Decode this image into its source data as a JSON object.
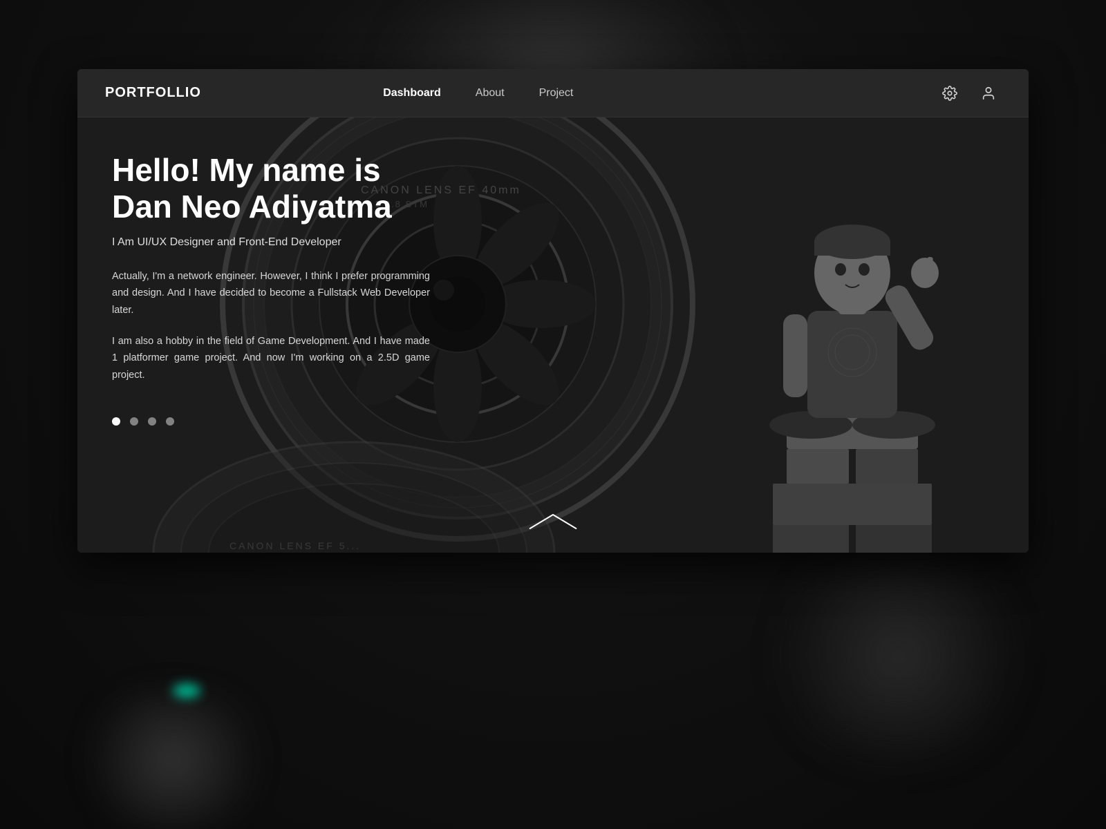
{
  "brand": "PORTFOLLIO",
  "nav": {
    "items": [
      {
        "label": "Dashboard",
        "active": true
      },
      {
        "label": "About",
        "active": false
      },
      {
        "label": "Project",
        "active": false
      }
    ]
  },
  "hero": {
    "title_line1": "Hello! My name is",
    "title_line2": "Dan Neo Adiyatma",
    "subtitle": "I Am UI/UX Designer and Front-End Developer",
    "body1": "Actually, I'm a network engineer. However, I think I prefer programming and design. And I have decided to become a Fullstack Web Developer later.",
    "body2": "I am also a hobby in the field of Game Development. And I have made 1 platformer game project. And now I'm working on a 2.5D game project.",
    "dots": [
      {
        "active": true
      },
      {
        "active": false
      },
      {
        "active": false
      },
      {
        "active": false
      }
    ]
  },
  "icons": {
    "settings": "⚙",
    "user": "👤"
  },
  "colors": {
    "brand_bg": "#282828",
    "hero_bg": "#1c1c1c",
    "text_primary": "#ffffff",
    "text_secondary": "rgba(255,255,255,0.82)",
    "accent": "#00b894"
  }
}
